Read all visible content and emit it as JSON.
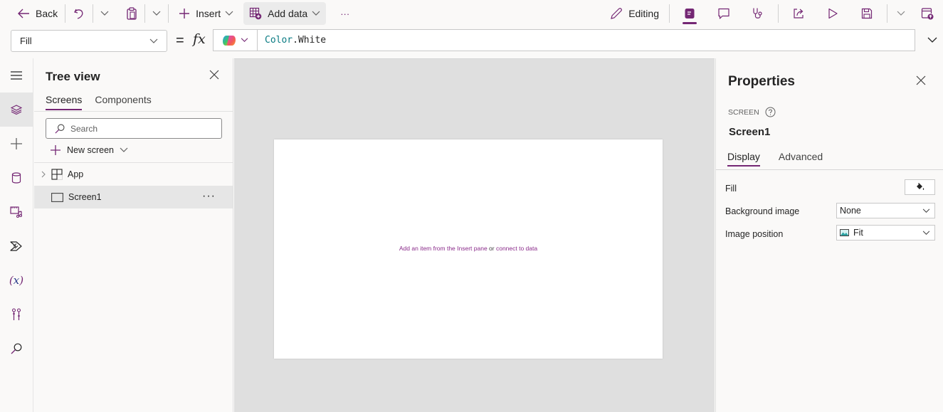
{
  "toolbar": {
    "back_label": "Back",
    "insert_label": "Insert",
    "add_data_label": "Add data",
    "more_label": "···",
    "editing_label": "Editing"
  },
  "formula_bar": {
    "property": "Fill",
    "equals": "=",
    "fx": "fx",
    "formula_object": "Color",
    "formula_dot": ".",
    "formula_property": "White"
  },
  "tree_view": {
    "title": "Tree view",
    "tabs": [
      {
        "label": "Screens",
        "active": true
      },
      {
        "label": "Components",
        "active": false
      }
    ],
    "search_placeholder": "Search",
    "new_screen_label": "New screen",
    "nodes": [
      {
        "label": "App",
        "type": "app",
        "expandable": true
      },
      {
        "label": "Screen1",
        "type": "screen",
        "selected": true,
        "more": "···"
      }
    ]
  },
  "canvas": {
    "hint_part1": "Add an item from the Insert pane",
    "hint_or": " or ",
    "hint_part2": "connect to data"
  },
  "properties": {
    "title": "Properties",
    "type_label": "SCREEN",
    "name": "Screen1",
    "tabs": [
      {
        "label": "Display",
        "active": true
      },
      {
        "label": "Advanced",
        "active": false
      }
    ],
    "rows": [
      {
        "label": "Fill",
        "control": "color"
      },
      {
        "label": "Background image",
        "value": "None"
      },
      {
        "label": "Image position",
        "value": "Fit"
      }
    ]
  },
  "colors": {
    "accent": "#742774",
    "canvas_bg": "#dfdfdf",
    "formula_object": "#0a7b83"
  }
}
